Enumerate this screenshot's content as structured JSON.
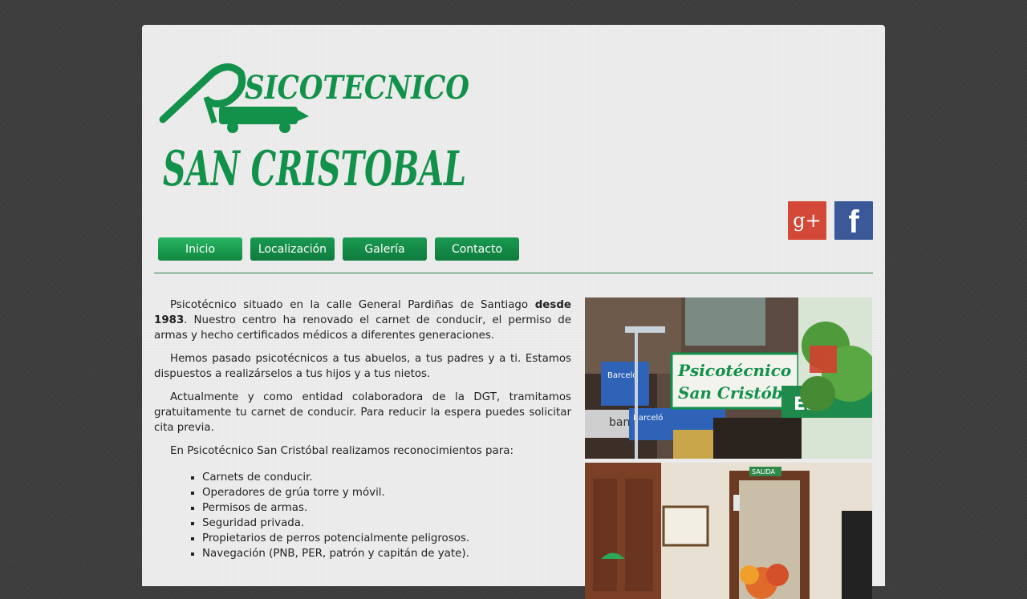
{
  "header": {
    "logo_text_line1": "PSICOTECNICO",
    "logo_text_line2": "SAN CRISTOBAL",
    "social": [
      {
        "label": "g+",
        "icon": "google-plus-icon",
        "color": "#d34836"
      },
      {
        "label": "f",
        "icon": "facebook-icon",
        "color": "#3b5998"
      }
    ]
  },
  "nav": {
    "items": [
      {
        "label": "Inicio",
        "active": true
      },
      {
        "label": "Localización",
        "active": false
      },
      {
        "label": "Galería",
        "active": false
      },
      {
        "label": "Contacto",
        "active": false
      }
    ]
  },
  "content": {
    "p1_before": "Psicotécnico situado en la calle General Pardiñas de Santiago ",
    "p1_bold": "desde 1983",
    "p1_after": ". Nuestro centro ha renovado el carnet de conducir, el permiso de armas y hecho certificados médicos a diferentes generaciones.",
    "p2": "Hemos pasado psicotécnicos a tus abuelos, a tus padres y a ti. Estamos dispuestos a realizárselos a tus hijos y a tus nietos.",
    "p3": "Actualmente y como entidad colaboradora de la DGT, tramitamos gratuitamente tu carnet de conducir. Para reducir la espera puedes solicitar cita previa.",
    "p4": "En Psicotécnico San Cristóbal realizamos reconocimientos para:",
    "list": [
      "Carnets de conducir.",
      "Operadores de grúa torre y móvil.",
      "Permisos de armas.",
      "Seguridad privada.",
      "Propietarios de perros potencialmente peligrosos.",
      "Navegación (PNB, PER, patrón y capitán de yate)."
    ]
  },
  "photos": {
    "storefront_sign_line1": "Psicotécnico",
    "storefront_sign_line2": "San Cristóbal",
    "storefront_shop1": "Barceló",
    "storefront_shop2": "Barceló",
    "storefront_shop3": "ban",
    "storefront_shop4": "ES",
    "interior_exit_sign": "SALIDA"
  },
  "colors": {
    "brand_green": "#12914a",
    "nav_green": "#0e7b3c",
    "background": "#3d3d3d",
    "panel": "#eeeeee"
  }
}
